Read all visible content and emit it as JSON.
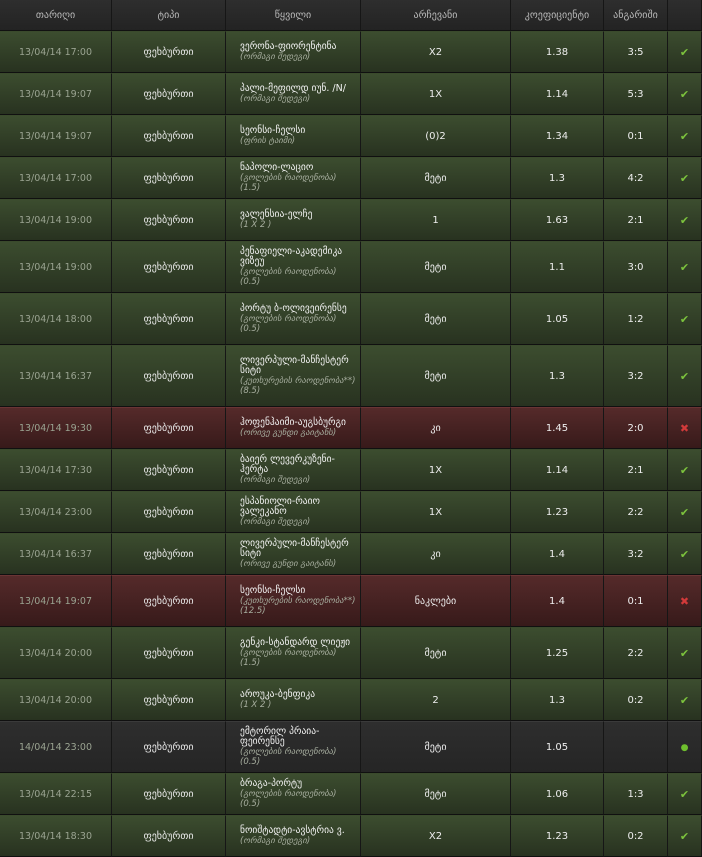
{
  "headers": {
    "date": "თარიღი",
    "type": "ტიპი",
    "event": "წყვილი",
    "choice": "არჩევანი",
    "coef": "კოეფიციენტი",
    "score": "ანგარიში"
  },
  "rows": [
    {
      "date": "13/04/14 17:00",
      "type": "ფეხბურთი",
      "event": "ვერონა-ფიორენტინა",
      "market": "(ორმაგი შედეგი)",
      "line": "",
      "choice": "X2",
      "coef": "1.38",
      "score": "3:5",
      "status": "won",
      "icon": "check-icon"
    },
    {
      "date": "13/04/14 19:07",
      "type": "ფეხბურთი",
      "event": "პალი-მეფილდ იუნ. /N/",
      "market": "(ორმაგი შედეგი)",
      "line": "",
      "choice": "1X",
      "coef": "1.14",
      "score": "5:3",
      "status": "won",
      "icon": "check-icon"
    },
    {
      "date": "13/04/14 19:07",
      "type": "ფეხბურთი",
      "event": "სეონსი-ჩელსი",
      "market": "(ფრის ტაიმი)",
      "line": "",
      "choice": "(0)2",
      "coef": "1.34",
      "score": "0:1",
      "status": "won",
      "icon": "check-icon"
    },
    {
      "date": "13/04/14 17:00",
      "type": "ფეხბურთი",
      "event": "ნაპოლი-ლაციო",
      "market": "(გოლების რაოდენობა)",
      "line": "(1.5)",
      "choice": "მეტი",
      "coef": "1.3",
      "score": "4:2",
      "status": "won",
      "icon": "check-icon"
    },
    {
      "date": "13/04/14 19:00",
      "type": "ფეხბურთი",
      "event": "ვალენსია-ელჩე",
      "market": "(1 X 2 )",
      "line": "",
      "choice": "1",
      "coef": "1.63",
      "score": "2:1",
      "status": "won",
      "icon": "check-icon"
    },
    {
      "date": "13/04/14 19:00",
      "type": "ფეხბურთი",
      "event": "პენაფიელი-აკადემიკა ვიზეუ",
      "market": "(გოლების რაოდენობა)",
      "line": "(0.5)",
      "choice": "მეტი",
      "coef": "1.1",
      "score": "3:0",
      "status": "won",
      "icon": "check-icon"
    },
    {
      "date": "13/04/14 18:00",
      "type": "ფეხბურთი",
      "event": "პორტუ ბ-ოლივეირენსე",
      "market": "(გოლების რაოდენობა)",
      "line": "(0.5)",
      "choice": "მეტი",
      "coef": "1.05",
      "score": "1:2",
      "status": "won",
      "icon": "check-icon"
    },
    {
      "date": "13/04/14 16:37",
      "type": "ფეხბურთი",
      "event": "ლივერპული-მანჩესტერ სიტი",
      "market": "(კუთხურების რაოდენობა**)",
      "line": "(8.5)",
      "choice": "მეტი",
      "coef": "1.3",
      "score": "3:2",
      "status": "won",
      "icon": "check-icon"
    },
    {
      "date": "13/04/14 19:30",
      "type": "ფეხბურთი",
      "event": "ჰოფენჰაიმი-აუგსბურგი",
      "market": "(ორივე გუნდი გაიტანს)",
      "line": "",
      "choice": "კი",
      "coef": "1.45",
      "score": "2:0",
      "status": "lost",
      "icon": "cross-icon"
    },
    {
      "date": "13/04/14 17:30",
      "type": "ფეხბურთი",
      "event": "ბაიერ ლევერკუზენი-ჰერტა",
      "market": "(ორმაგი შედეგი)",
      "line": "",
      "choice": "1X",
      "coef": "1.14",
      "score": "2:1",
      "status": "won",
      "icon": "check-icon"
    },
    {
      "date": "13/04/14 23:00",
      "type": "ფეხბურთი",
      "event": "ესპანიოლი-რაიო ვალეკანო",
      "market": "(ორმაგი შედეგი)",
      "line": "",
      "choice": "1X",
      "coef": "1.23",
      "score": "2:2",
      "status": "won",
      "icon": "check-icon"
    },
    {
      "date": "13/04/14 16:37",
      "type": "ფეხბურთი",
      "event": "ლივერპული-მანჩესტერ სიტი",
      "market": "(ორივე გუნდი გაიტანს)",
      "line": "",
      "choice": "კი",
      "coef": "1.4",
      "score": "3:2",
      "status": "won",
      "icon": "check-icon"
    },
    {
      "date": "13/04/14 19:07",
      "type": "ფეხბურთი",
      "event": "სეონსი-ჩელსი",
      "market": "(კუთხურების რაოდენობა**)",
      "line": "(12.5)",
      "choice": "ნაკლები",
      "coef": "1.4",
      "score": "0:1",
      "status": "lost",
      "icon": "cross-icon"
    },
    {
      "date": "13/04/14 20:00",
      "type": "ფეხბურთი",
      "event": "გენკი-სტანდარდ ლიეჟი",
      "market": "(გოლების რაოდენობა)",
      "line": "(1.5)",
      "choice": "მეტი",
      "coef": "1.25",
      "score": "2:2",
      "status": "won",
      "icon": "check-icon"
    },
    {
      "date": "13/04/14 20:00",
      "type": "ფეხბურთი",
      "event": "აროუკა-ბენფიკა",
      "market": "(1 X 2 )",
      "line": "",
      "choice": "2",
      "coef": "1.3",
      "score": "0:2",
      "status": "won",
      "icon": "check-icon"
    },
    {
      "date": "14/04/14 23:00",
      "type": "ფეხბურთი",
      "event": "ემტორილ პრაია-ფეირენსე",
      "market": "(გოლების რაოდენობა)",
      "line": "(0.5)",
      "choice": "მეტი",
      "coef": "1.05",
      "score": "",
      "status": "pending",
      "icon": "dot-icon"
    },
    {
      "date": "13/04/14 22:15",
      "type": "ფეხბურთი",
      "event": "ბრაგა-პორტუ",
      "market": "(გოლების რაოდენობა)",
      "line": "(0.5)",
      "choice": "მეტი",
      "coef": "1.06",
      "score": "1:3",
      "status": "won",
      "icon": "check-icon"
    },
    {
      "date": "13/04/14 18:30",
      "type": "ფეხბურთი",
      "event": "ნოიშტადტი-ავსტრია ვ.",
      "market": "(ორმაგი შედეგი)",
      "line": "",
      "choice": "X2",
      "coef": "1.23",
      "score": "0:2",
      "status": "won",
      "icon": "check-icon"
    }
  ]
}
